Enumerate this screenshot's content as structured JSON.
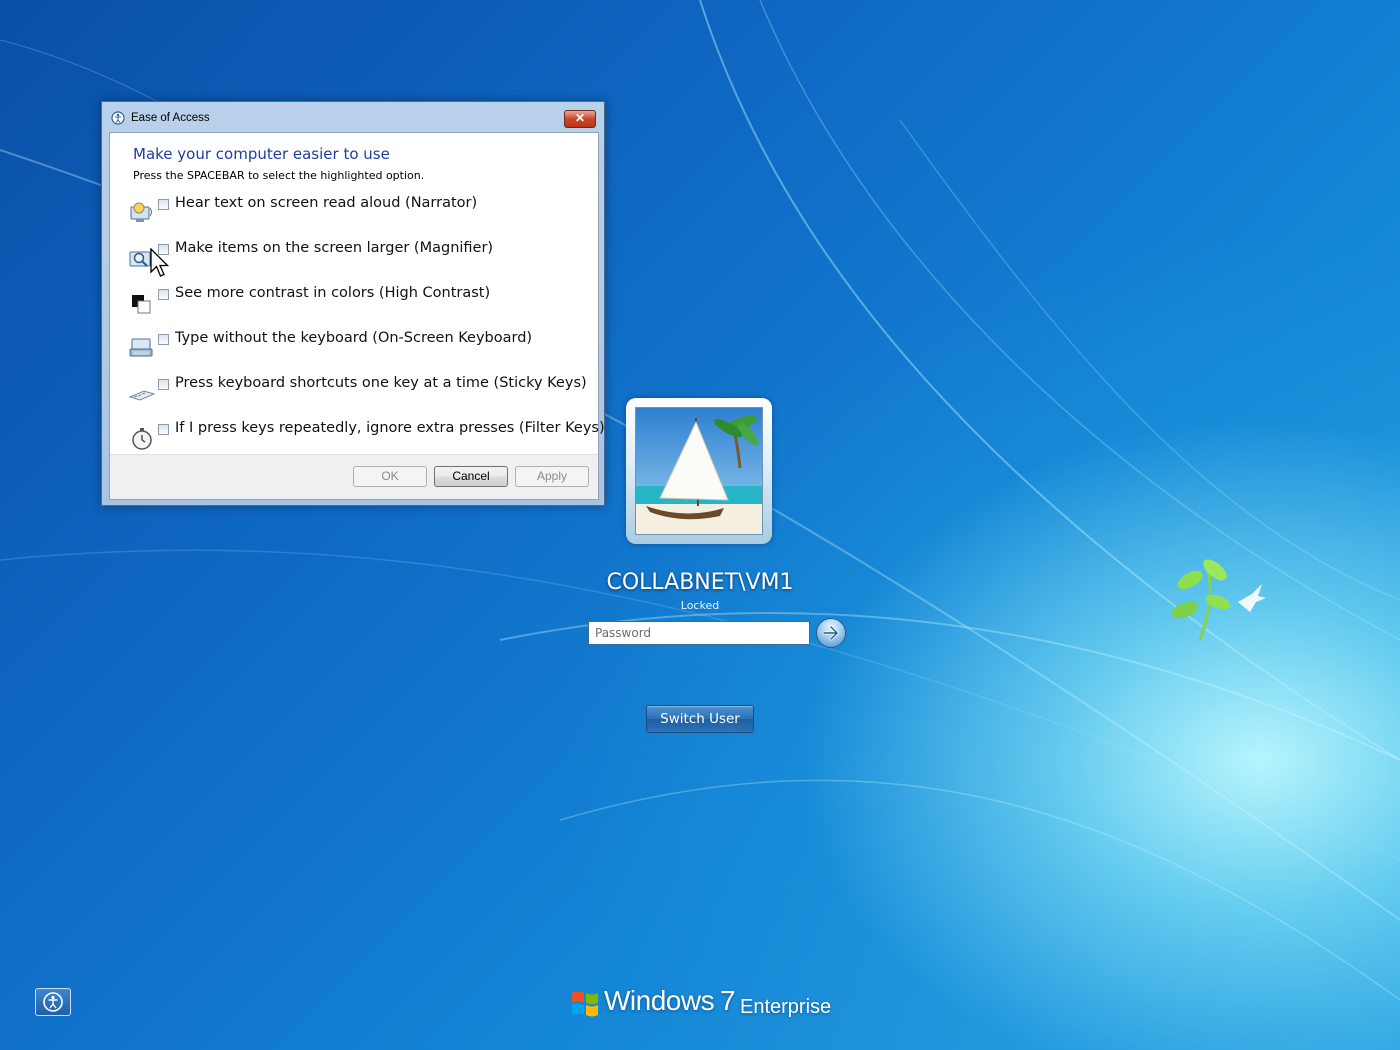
{
  "dialog": {
    "title": "Ease of Access",
    "close_label": "✕",
    "heading": "Make your computer easier to use",
    "hint": "Press the SPACEBAR to select the highlighted option.",
    "options": [
      {
        "label": "Hear text on screen read aloud (Narrator)",
        "icon": "narrator-icon",
        "checked": false
      },
      {
        "label": "Make items on the screen larger (Magnifier)",
        "icon": "magnifier-icon",
        "checked": false
      },
      {
        "label": "See more contrast in colors (High Contrast)",
        "icon": "high-contrast-icon",
        "checked": false
      },
      {
        "label": "Type without the keyboard (On-Screen Keyboard)",
        "icon": "on-screen-keyboard-icon",
        "checked": false
      },
      {
        "label": "Press keyboard shortcuts one key at a time (Sticky Keys)",
        "icon": "sticky-keys-icon",
        "checked": false
      },
      {
        "label": "If I press keys repeatedly, ignore extra presses (Filter Keys)",
        "icon": "filter-keys-icon",
        "checked": false
      }
    ],
    "buttons": {
      "ok": "OK",
      "cancel": "Cancel",
      "apply": "Apply"
    }
  },
  "logon": {
    "username": "COLLABNET\\VM1",
    "status": "Locked",
    "password_placeholder": "Password",
    "switch_user_label": "Switch User"
  },
  "branding": {
    "name": "Windows",
    "version": "7",
    "edition": "Enterprise"
  },
  "colors": {
    "heading": "#1e3da0",
    "background_dark": "#0a4fa8",
    "background_light": "#2aa2e2"
  }
}
